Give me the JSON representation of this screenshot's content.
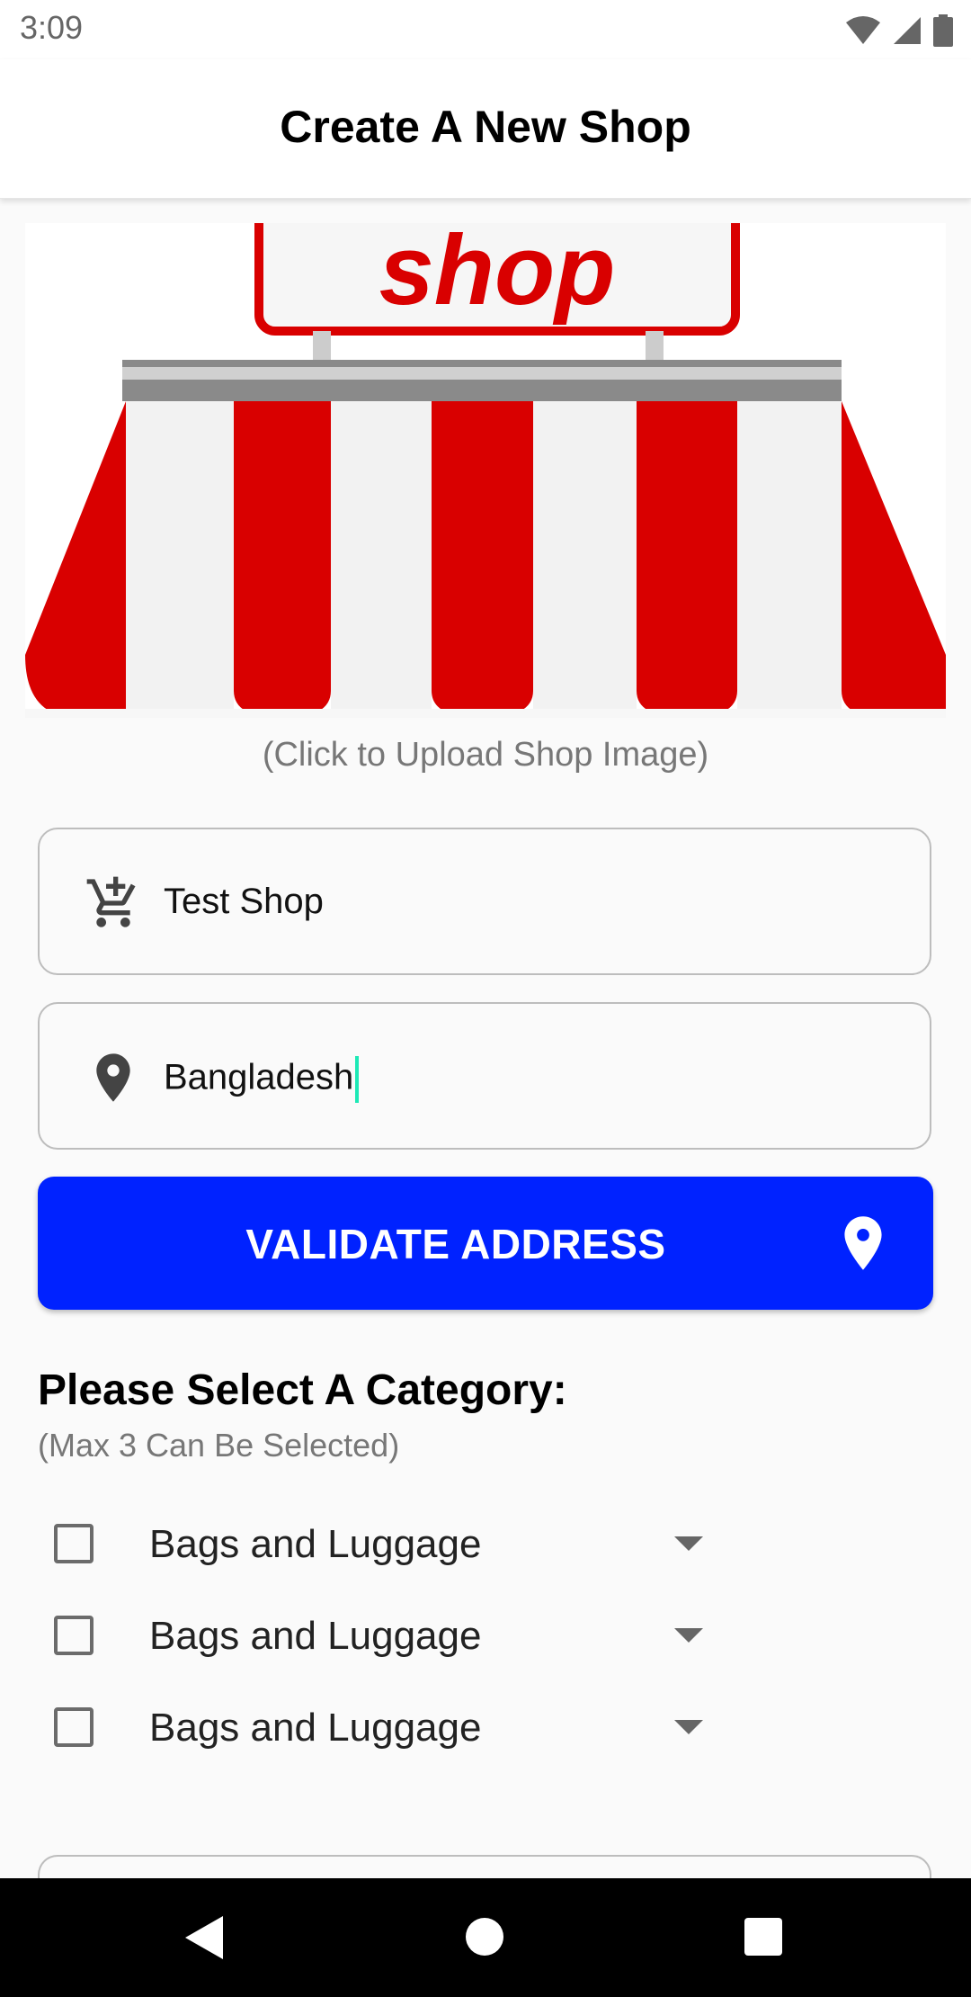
{
  "status_bar": {
    "time": "3:09",
    "icons": [
      "wifi-icon",
      "signal-icon",
      "battery-icon"
    ]
  },
  "header": {
    "title": "Create A New Shop"
  },
  "shop_image": {
    "sign_text": "shop",
    "caption": "(Click to Upload Shop Image)"
  },
  "form": {
    "shop_name": {
      "icon": "cart-icon",
      "value": "Test Shop"
    },
    "address": {
      "icon": "location-pin-icon",
      "value": "Bangladesh"
    },
    "validate_button": {
      "label": "VALIDATE ADDRESS",
      "icon": "location-pin-icon"
    }
  },
  "categories": {
    "heading": "Please Select A Category:",
    "subtext": "(Max 3 Can Be Selected)",
    "items": [
      {
        "label": "Bags and Luggage",
        "checked": false
      },
      {
        "label": "Bags and Luggage",
        "checked": false
      },
      {
        "label": "Bags and Luggage",
        "checked": false
      }
    ]
  },
  "colors": {
    "accent": "#0022ff",
    "awning_red": "#d90000",
    "cursor": "#1de9b6"
  },
  "nav_bar": {
    "buttons": [
      "back-icon",
      "home-icon",
      "recents-icon"
    ]
  }
}
